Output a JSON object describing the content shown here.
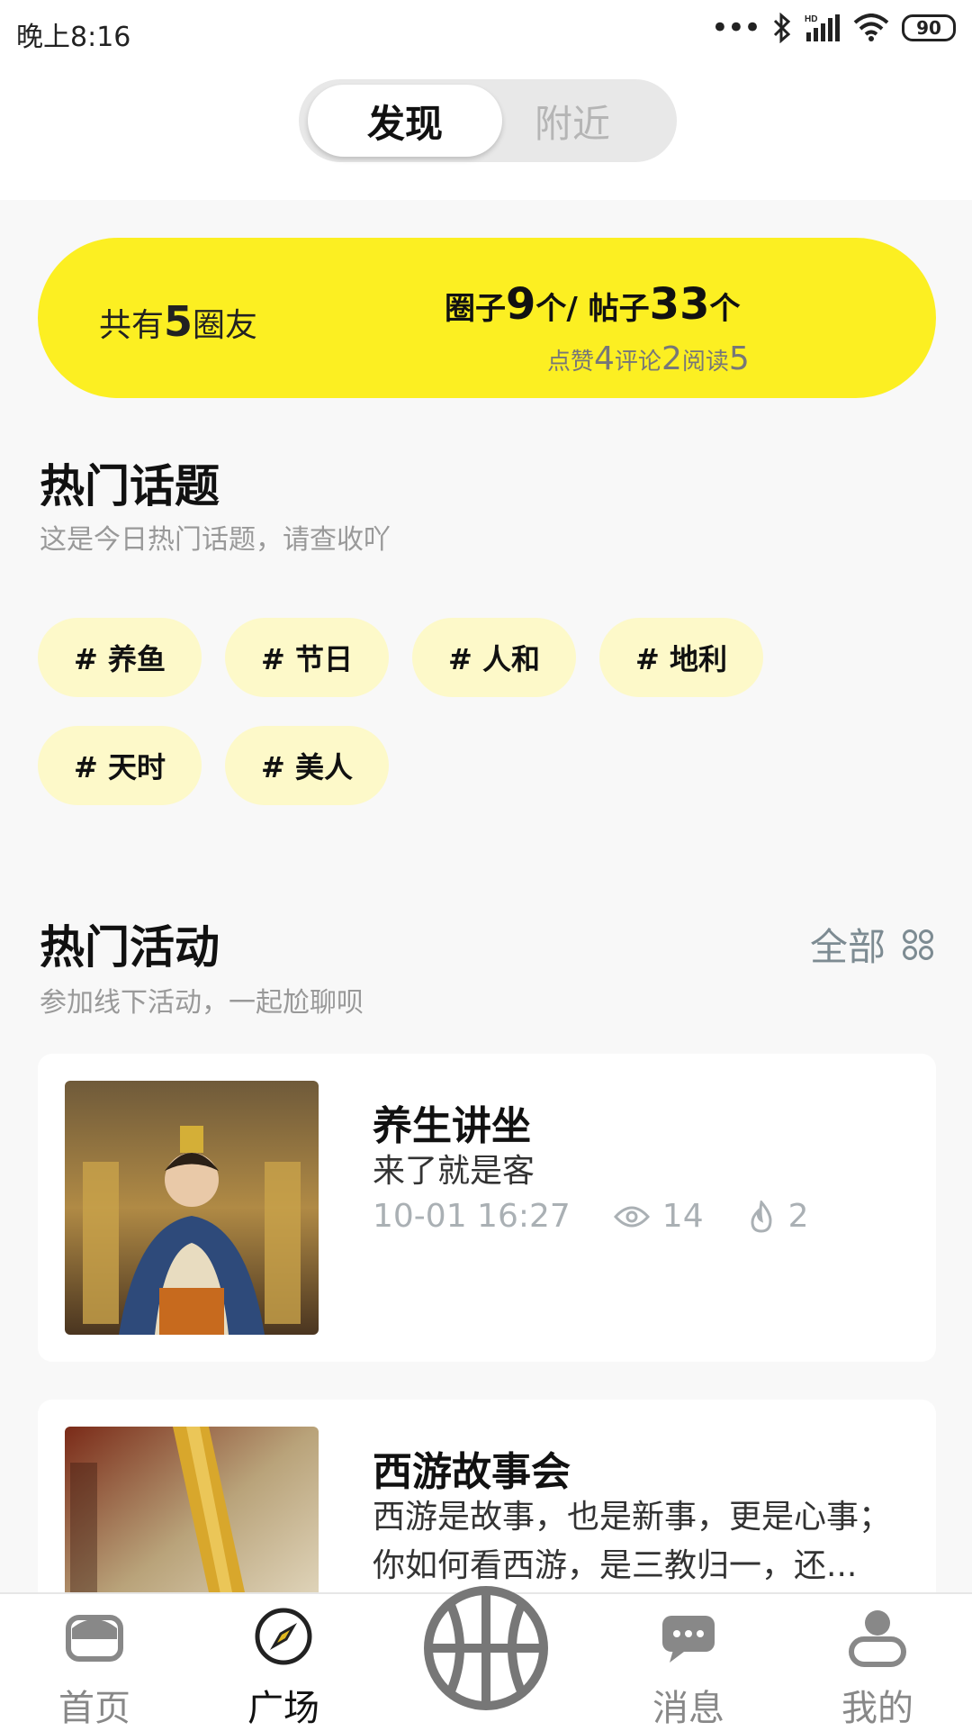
{
  "status_bar": {
    "time": "晚上8:16",
    "battery": "90"
  },
  "header": {
    "tabs": [
      "发现",
      "附近"
    ]
  },
  "stats": {
    "friends_prefix": "共有",
    "friends_count": "5",
    "friends_suffix": "圈友",
    "circles_prefix": "圈子",
    "circles_count": "9",
    "circles_suffix": "个/ ",
    "posts_prefix": "帖子",
    "posts_count": "33",
    "posts_suffix": "个",
    "likes_label": "点赞",
    "likes_count": "4",
    "comments_label": "评论",
    "comments_count": "2",
    "reads_label": "阅读",
    "reads_count": "5"
  },
  "hot_topics": {
    "title": "热门话题",
    "subtitle": "这是今日热门话题，请查收吖",
    "chips": [
      "# 养鱼",
      "# 节日",
      "# 人和",
      "# 地利",
      "# 天时",
      "# 美人"
    ]
  },
  "hot_activities": {
    "title": "热门活动",
    "subtitle": "参加线下活动，一起尬聊呗",
    "more_label": "全部",
    "cards": [
      {
        "title": "养生讲坐",
        "desc": "来了就是客",
        "time": "10-01 16:27",
        "views": "14",
        "hot": "2"
      },
      {
        "title": "西游故事会",
        "desc": "西游是故事，也是新事，更是心事；你如何看西游，是三教归一，还..."
      }
    ]
  },
  "tabbar": {
    "items": [
      "首页",
      "广场",
      "消息",
      "我的"
    ]
  },
  "colors": {
    "accent": "#fcef22",
    "chip": "#fdf9c9",
    "muted": "#aab0b4"
  }
}
